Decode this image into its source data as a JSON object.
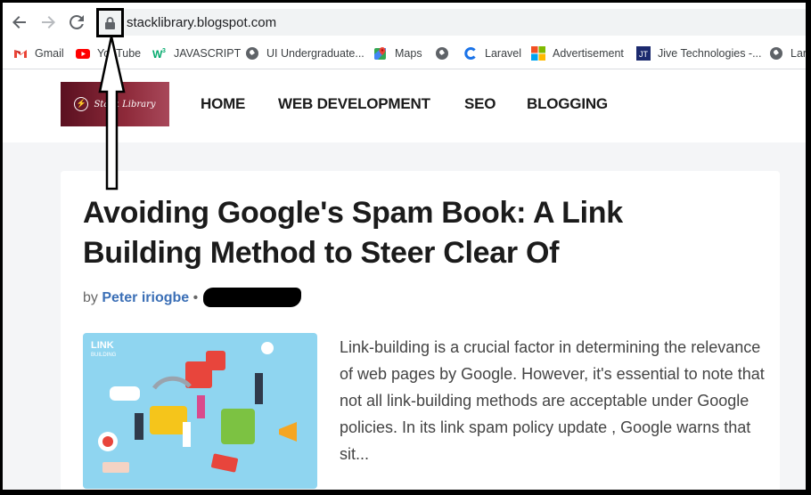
{
  "browser": {
    "url": "stacklibrary.blogspot.com",
    "bookmarks": [
      {
        "label": "Gmail",
        "icon": "gmail-icon"
      },
      {
        "label": "YouTube",
        "icon": "youtube-icon"
      },
      {
        "label": "JAVASCRIPT",
        "icon": "w3schools-icon"
      },
      {
        "label": "UI Undergraduate...",
        "icon": "globe-icon"
      },
      {
        "label": "Maps",
        "icon": "maps-icon"
      },
      {
        "label": "",
        "icon": "globe-icon"
      },
      {
        "label": "Laravel",
        "icon": "laravel-icon"
      },
      {
        "label": "Advertisement",
        "icon": "microsoft-icon"
      },
      {
        "label": "Jive Technologies -...",
        "icon": "jive-icon"
      },
      {
        "label": "Lar",
        "icon": "globe-icon"
      }
    ]
  },
  "site": {
    "logo_text": "Stack Library",
    "nav": [
      "HOME",
      "WEB DEVELOPMENT",
      "SEO",
      "BLOGGING"
    ]
  },
  "post": {
    "title": "Avoiding Google's Spam Book: A Link Building Method to Steer Clear Of",
    "by": "by",
    "author": "Peter iriogbe",
    "separator": "•",
    "thumbnail_label_1": "LINK",
    "thumbnail_label_2": "BUILDING",
    "excerpt": "Link-building is a crucial factor in determining the relevance of web pages by Google. However, it's essential to note that not all link-building methods are acceptable under Google policies. In its link spam policy update , Google warns that sit..."
  },
  "colors": {
    "author_link": "#3b6fb6",
    "logo_bg": "#8e2a3a",
    "thumb_bg": "#8fd5f0"
  }
}
